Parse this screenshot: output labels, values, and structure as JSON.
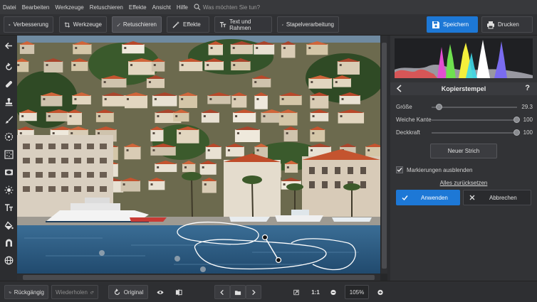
{
  "menubar": {
    "items": [
      "Datei",
      "Bearbeiten",
      "Werkzeuge",
      "Retuschieren",
      "Effekte",
      "Ansicht",
      "Hilfe"
    ],
    "search_placeholder": "Was möchten Sie tun?"
  },
  "toolbar": {
    "verbesserung": "Verbesserung",
    "werkzeuge": "Werkzeuge",
    "retuschieren": "Retuschieren",
    "effekte": "Effekte",
    "text_rahmen": "Text und Rahmen",
    "stapel": "Stapelverarbeitung",
    "speichern": "Speichern",
    "drucken": "Drucken"
  },
  "panel": {
    "title": "Kopierstempel",
    "help": "?",
    "sliders": [
      {
        "label": "Größe",
        "value": "29.3",
        "level": 0.08
      },
      {
        "label": "Weiche Kante",
        "value": "100",
        "level": 1.0
      },
      {
        "label": "Deckkraft",
        "value": "100",
        "level": 1.0
      }
    ],
    "new_stroke": "Neuer Strich",
    "hide_markings": "Markierungen ausblenden",
    "hide_markings_checked": true,
    "reset_all": "Alles zurücksetzen",
    "apply": "Anwenden",
    "cancel": "Abbrechen"
  },
  "bottombar": {
    "undo": "Rückgängig",
    "redo": "Wiederholen",
    "original": "Original",
    "fit_label": "1:1",
    "zoom": "105%"
  },
  "colors": {
    "accent": "#1d78d6",
    "panel_bg": "#323336",
    "app_bg": "#2b2c2f"
  }
}
